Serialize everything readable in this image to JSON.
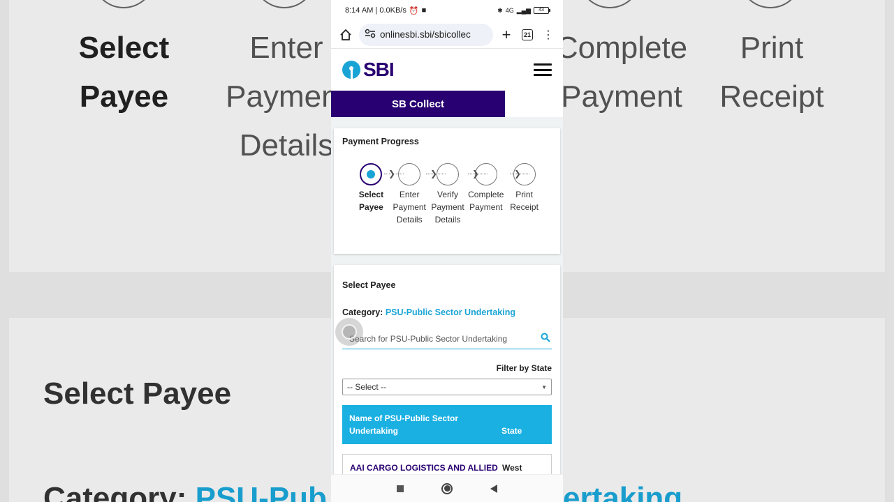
{
  "status": {
    "time": "8:14 AM | 0.0KB/s",
    "network": "4G",
    "battery": "43"
  },
  "browser": {
    "url": "onlinesbi.sbi/sbicollec",
    "tab_count": "21"
  },
  "site": {
    "logo_text": "SBI",
    "module_tab": "SB Collect"
  },
  "progress": {
    "title": "Payment Progress",
    "steps": [
      {
        "line1": "Select",
        "line2": "Payee",
        "line3": ""
      },
      {
        "line1": "Enter",
        "line2": "Payment",
        "line3": "Details"
      },
      {
        "line1": "Verify",
        "line2": "Payment",
        "line3": "Details"
      },
      {
        "line1": "Complete",
        "line2": "Payment",
        "line3": ""
      },
      {
        "line1": "Print",
        "line2": "Receipt",
        "line3": ""
      }
    ]
  },
  "payee": {
    "title": "Select Payee",
    "category_label": "Category:",
    "category_value": "PSU-Public Sector Undertaking",
    "search_placeholder": "Search for PSU-Public Sector Undertaking",
    "filter_label": "Filter by State",
    "select_value": "-- Select --",
    "table": {
      "col1_line1": "Name of PSU-Public Sector",
      "col1_line2": "Undertaking",
      "col2": "State",
      "rows": [
        {
          "name": "AAI CARGO LOGISTICS AND ALLIED",
          "state": "West"
        }
      ]
    }
  },
  "background": {
    "steps": [
      {
        "line1": "Select",
        "line2": "Payee",
        "line3": ""
      },
      {
        "line1": "Enter",
        "line2": "Payment",
        "line3": "Details"
      },
      {
        "line1": "Complete",
        "line2": "Payment",
        "line3": ""
      },
      {
        "line1": "Print",
        "line2": "Receipt",
        "line3": ""
      }
    ],
    "heading": "Select Payee",
    "category_label": "Category:",
    "category_value": "PSU-Pub",
    "category_tail": "ertaking"
  }
}
